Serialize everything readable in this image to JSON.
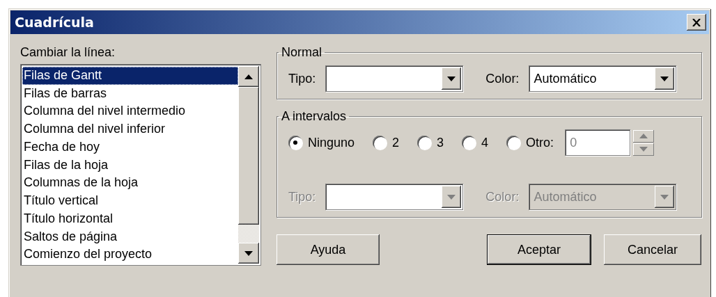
{
  "window": {
    "title": "Cuadrícula"
  },
  "line_list": {
    "label": "Cambiar la línea:",
    "items": [
      {
        "text": "Filas de Gantt",
        "selected": true
      },
      {
        "text": "Filas de barras",
        "selected": false
      },
      {
        "text": "Columna del nivel intermedio",
        "selected": false
      },
      {
        "text": "Columna del nivel inferior",
        "selected": false
      },
      {
        "text": "Fecha de hoy",
        "selected": false
      },
      {
        "text": "Filas de la hoja",
        "selected": false
      },
      {
        "text": "Columnas de la hoja",
        "selected": false
      },
      {
        "text": "Título vertical",
        "selected": false
      },
      {
        "text": "Título horizontal",
        "selected": false
      },
      {
        "text": "Saltos de página",
        "selected": false
      },
      {
        "text": "Comienzo del proyecto",
        "selected": false
      }
    ]
  },
  "normal": {
    "title": "Normal",
    "type_label": "Tipo:",
    "color_label": "Color:",
    "color_value": "Automático"
  },
  "intervals": {
    "title": "A intervalos",
    "options": [
      {
        "label": "Ninguno",
        "selected": true
      },
      {
        "label": "2",
        "selected": false
      },
      {
        "label": "3",
        "selected": false
      },
      {
        "label": "4",
        "selected": false
      },
      {
        "label": "Otro:",
        "selected": false
      }
    ],
    "other_value": "0",
    "disabled": true,
    "type_label": "Tipo:",
    "color_label": "Color:",
    "color_value": "Automático"
  },
  "buttons": [
    {
      "label": "Ayuda",
      "default": false
    },
    {
      "label": "Aceptar",
      "default": true
    },
    {
      "label": "Cancelar",
      "default": false
    }
  ]
}
